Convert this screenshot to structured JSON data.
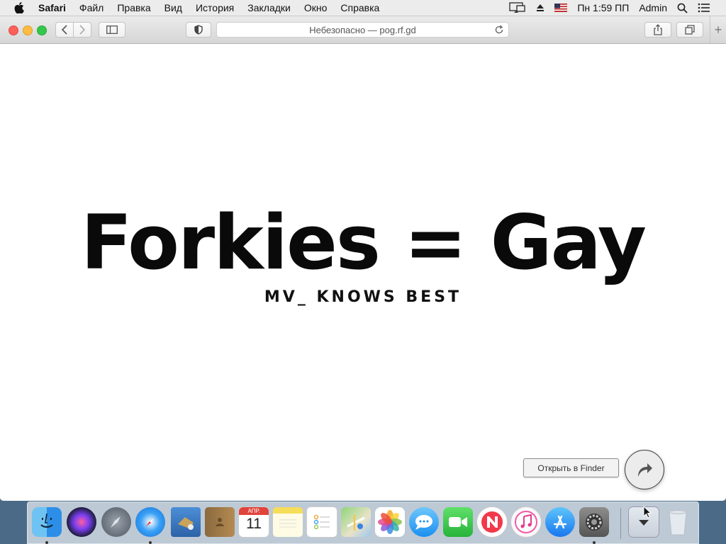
{
  "menubar": {
    "app_name": "Safari",
    "items": [
      "Файл",
      "Правка",
      "Вид",
      "История",
      "Закладки",
      "Окно",
      "Справка"
    ],
    "clock": "Пн 1:59 ПП",
    "user": "Admin"
  },
  "browser": {
    "address": "Небезопасно — pog.rf.gd",
    "new_tab_symbol": "+"
  },
  "page": {
    "title": "Forkies = Gay",
    "subtitle": "MV_ KNOWS BEST"
  },
  "overlay": {
    "finder_button": "Открыть в Finder"
  },
  "calendar": {
    "month": "АПР.",
    "day": "11"
  },
  "dock": {
    "apps": [
      "Finder",
      "Siri",
      "Launchpad",
      "Safari",
      "Mail",
      "Contacts",
      "Calendar",
      "Notes",
      "Reminders",
      "Maps",
      "Photos",
      "Messages",
      "FaceTime",
      "News",
      "iTunes",
      "App Store",
      "System Preferences",
      "Downloads",
      "Trash"
    ]
  },
  "colors": {
    "traffic_close": "#fc605b",
    "traffic_minimize": "#fdbc40",
    "traffic_maximize": "#34c84a",
    "page_text": "#0a0a0a"
  }
}
